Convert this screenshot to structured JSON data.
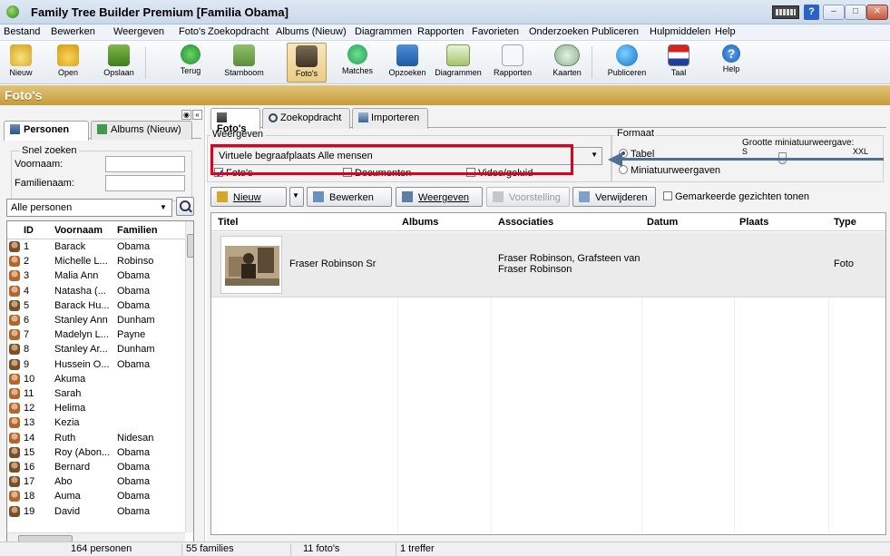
{
  "window": {
    "title": "Family Tree Builder Premium [Familia Obama]"
  },
  "menu": [
    "Bestand",
    "Bewerken",
    "Weergeven",
    "Foto's",
    "Zoekopdracht",
    "Albums (Nieuw)",
    "Diagrammen",
    "Rapporten",
    "Favorieten",
    "Onderzoeken",
    "Publiceren",
    "Hulpmiddelen",
    "Help"
  ],
  "toolbar": {
    "nieuw": "Nieuw",
    "open": "Open",
    "opslaan": "Opslaan",
    "terug": "Terug",
    "stamboom": "Stamboom",
    "fotos": "Foto's",
    "matches": "Matches",
    "opzoeken": "Opzoeken",
    "diagrammen": "Diagrammen",
    "rapporten": "Rapporten",
    "kaarten": "Kaarten",
    "publiceren": "Publiceren",
    "taal": "Taal",
    "help": "Help"
  },
  "section_title": "Foto's",
  "left": {
    "tab_personen": "Personen",
    "tab_albums": "Albums (Nieuw)",
    "quick_search": "Snel zoeken",
    "voornaam_label": "Voornaam:",
    "familienaam_label": "Familienaam:",
    "filter": "Alle personen",
    "columns": {
      "id": "ID",
      "voornaam": "Voornaam",
      "familienaam": "Familien"
    },
    "people": [
      {
        "id": "1",
        "first": "Barack",
        "last": "Obama",
        "sex": "m"
      },
      {
        "id": "2",
        "first": "Michelle L...",
        "last": "Robinso",
        "sex": "f"
      },
      {
        "id": "3",
        "first": "Malia Ann",
        "last": "Obama",
        "sex": "f"
      },
      {
        "id": "4",
        "first": "Natasha (...",
        "last": "Obama",
        "sex": "f"
      },
      {
        "id": "5",
        "first": "Barack Hu...",
        "last": "Obama",
        "sex": "m"
      },
      {
        "id": "6",
        "first": "Stanley Ann",
        "last": "Dunham",
        "sex": "f"
      },
      {
        "id": "7",
        "first": "Madelyn L...",
        "last": "Payne",
        "sex": "f"
      },
      {
        "id": "8",
        "first": "Stanley Ar...",
        "last": "Dunham",
        "sex": "m"
      },
      {
        "id": "9",
        "first": "Hussein O...",
        "last": "Obama",
        "sex": "m"
      },
      {
        "id": "10",
        "first": "Akuma",
        "last": "",
        "sex": "f"
      },
      {
        "id": "11",
        "first": "Sarah",
        "last": "",
        "sex": "f"
      },
      {
        "id": "12",
        "first": "Helima",
        "last": "",
        "sex": "f"
      },
      {
        "id": "13",
        "first": "Kezia",
        "last": "",
        "sex": "f"
      },
      {
        "id": "14",
        "first": "Ruth",
        "last": "Nidesan",
        "sex": "f"
      },
      {
        "id": "15",
        "first": "Roy (Abon...",
        "last": "Obama",
        "sex": "m"
      },
      {
        "id": "16",
        "first": "Bernard",
        "last": "Obama",
        "sex": "m"
      },
      {
        "id": "17",
        "first": "Abo",
        "last": "Obama",
        "sex": "m"
      },
      {
        "id": "18",
        "first": "Auma",
        "last": "Obama",
        "sex": "f"
      },
      {
        "id": "19",
        "first": "David",
        "last": "Obama",
        "sex": "m"
      }
    ]
  },
  "right": {
    "tab_fotos": "Foto's",
    "tab_zoek": "Zoekopdracht",
    "tab_import": "Importeren",
    "weergeven_label": "Weergeven",
    "view_select": "Virtuele begraafplaats Alle mensen",
    "chk_fotos": "Foto's",
    "chk_documenten": "Documenten",
    "chk_video": "Video/geluid",
    "formaat_label": "Formaat",
    "radio_tabel": "Tabel",
    "radio_miniatuur": "Miniatuurweergaven",
    "thumb_size_label": "Grootte miniatuurweergave:",
    "size_small": "S",
    "size_large": "XXL",
    "btn_nieuw": "Nieuw",
    "btn_bewerken": "Bewerken",
    "btn_weergeven": "Weergeven",
    "btn_voorstelling": "Voorstelling",
    "btn_verwijderen": "Verwijderen",
    "chk_faces": "Gemarkeerde gezichten tonen",
    "columns": {
      "titel": "Titel",
      "albums": "Albums",
      "associaties": "Associaties",
      "datum": "Datum",
      "plaats": "Plaats",
      "type": "Type"
    },
    "row": {
      "titel": "Fraser Robinson Sr",
      "associaties": "Fraser Robinson, Grafsteen van Fraser Robinson",
      "type": "Foto"
    }
  },
  "status": {
    "persons": "164 personen",
    "families": "55 families",
    "photos": "11 foto's",
    "hits": "1 treffer"
  },
  "colors": {
    "accent_gold": "#c79c38",
    "highlight_red": "#e0001b",
    "arrow_blue": "#506f95"
  }
}
